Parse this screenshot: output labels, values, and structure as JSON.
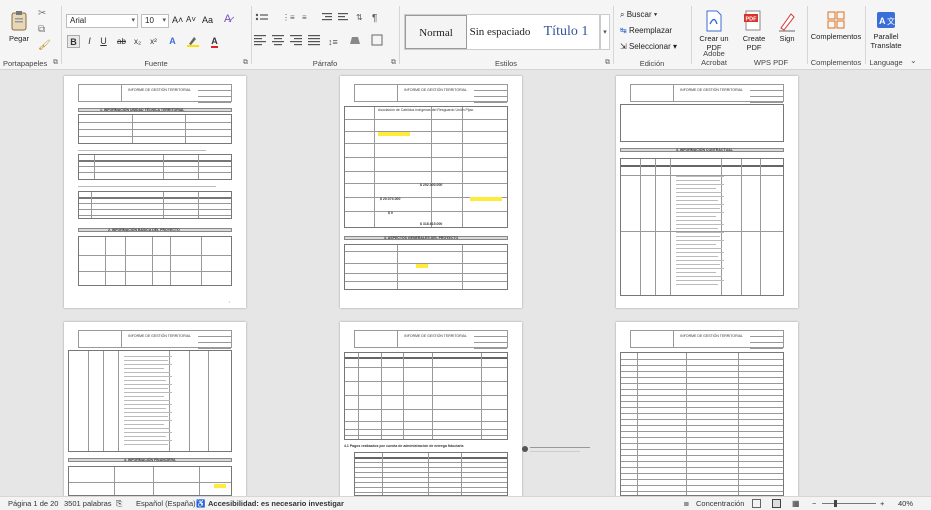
{
  "ribbon": {
    "clipboard": {
      "paste_label": "Pegar",
      "group_label": "Portapapeles"
    },
    "font": {
      "font_name": "Arial",
      "font_size": "10",
      "grow": "A˄",
      "shrink": "A˅",
      "case": "Aa",
      "bold": "B",
      "italic": "I",
      "underline": "U",
      "strike": "ab",
      "sub": "x₂",
      "sup": "x²",
      "group_label": "Fuente"
    },
    "paragraph": {
      "group_label": "Párrafo"
    },
    "styles": {
      "items": [
        "Normal",
        "Sin espaciado",
        "Título 1"
      ],
      "group_label": "Estilos"
    },
    "editing": {
      "search": "Buscar",
      "replace": "Reemplazar",
      "select": "Seleccionar",
      "group_label": "Edición"
    },
    "acrobat": {
      "create_pdf": "Crear un PDF",
      "group_label": "Adobe Acrobat"
    },
    "wps": {
      "create_pdf": "Create PDF",
      "sign": "Sign",
      "group_label": "WPS PDF"
    },
    "complements": {
      "label": "Complementos",
      "group_label": "Complementos"
    },
    "language": {
      "translate": "Parallel Translate",
      "group_label": "Language"
    }
  },
  "pages": {
    "page1": {
      "section1": "1. INFORMACIÓN UNIDAD TÉCNICA TERRITORIAL",
      "section2": "2. INFORMACIÓN BÁSICA DEL PROYECTO"
    },
    "page2": {
      "org_name": "Asociación de Cabildos Indígenas del Resguardo Unión Pijao",
      "amount1": "$ 202.000.000",
      "amount2": "$ 20.073.000",
      "amount3": "$ 0",
      "amount4": "$ 318.615.000",
      "section": "3. ASPECTOS GENERALES DEL PROYECTO"
    },
    "page3": {
      "section": "3. INFORMACIÓN CONTRACTUAL"
    },
    "page4": {
      "section": "4. INFORMACIÓN FINANCIERA"
    },
    "page5": {
      "section": "4.1 Pagos realizados por cuenta de administración de entrega fiduciaria"
    }
  },
  "statusbar": {
    "page": "Página 1 de 20",
    "words": "3501 palabras",
    "language": "Español (España)",
    "accessibility": "Accesibilidad: es necesario investigar",
    "focus": "Concentración",
    "zoom": "40%"
  }
}
